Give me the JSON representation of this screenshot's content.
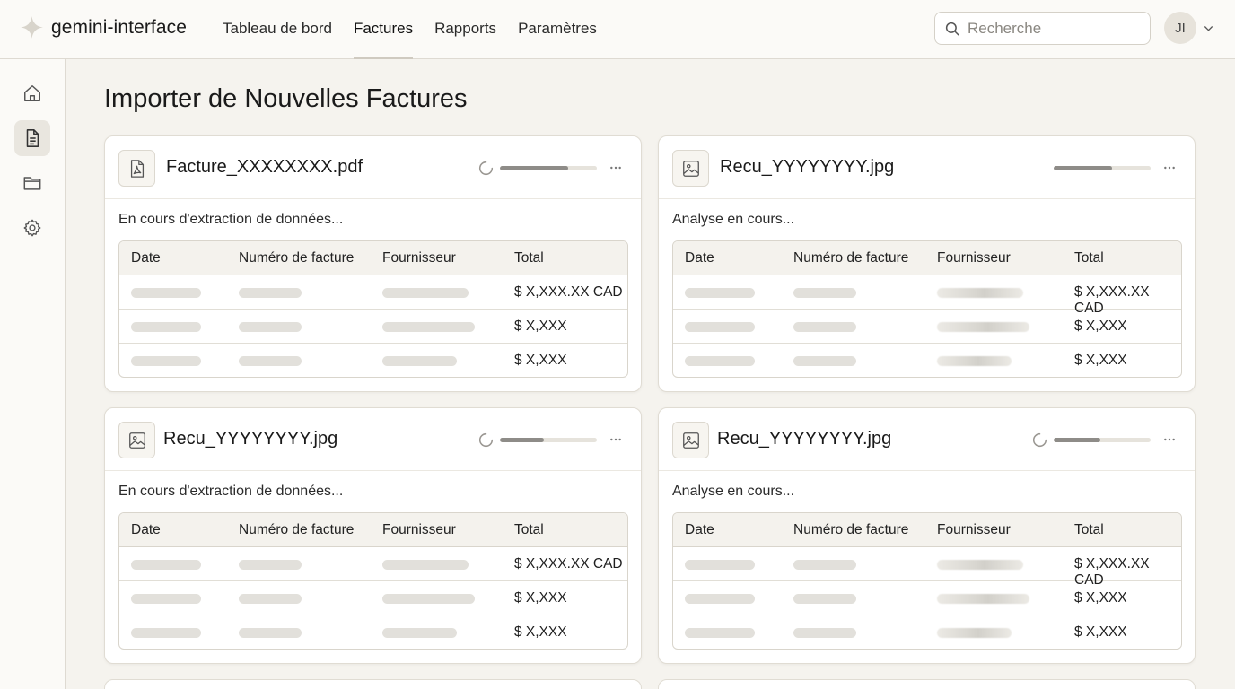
{
  "app": {
    "name": "gemini-interface"
  },
  "nav": {
    "items": [
      {
        "label": "Tableau de bord",
        "active": false
      },
      {
        "label": "Factures",
        "active": true
      },
      {
        "label": "Rapports",
        "active": false
      },
      {
        "label": "Paramètres",
        "active": false
      }
    ]
  },
  "search": {
    "placeholder": "Recherche",
    "value": ""
  },
  "user": {
    "initials": "JI"
  },
  "sidebar": {
    "items": [
      {
        "icon": "home-icon",
        "active": false
      },
      {
        "icon": "document-icon",
        "active": true
      },
      {
        "icon": "folder-icon",
        "active": false
      },
      {
        "icon": "gear-icon",
        "active": false
      }
    ]
  },
  "page": {
    "title": "Importer de Nouvelles Factures"
  },
  "table_headers": [
    "Date",
    "Numéro de facture",
    "Fournisseur",
    "Total"
  ],
  "cards": [
    {
      "file_name": "Facture_XXXXXXXX.pdf",
      "file_type_icon": "pdf-icon",
      "loading": true,
      "progress": 0.7,
      "status": "En cours d'extraction de données...",
      "totals": [
        "$ X,XXX.XX CAD",
        "$ X,XXX",
        "$ X,XXX"
      ]
    },
    {
      "file_name": "Recu_YYYYYYYY.jpg",
      "file_type_icon": "image-icon",
      "loading": false,
      "progress": 0.6,
      "status": "Analyse en cours...",
      "totals": [
        "$ X,XXX.XX CAD",
        "$ X,XXX",
        "$ X,XXX"
      ]
    },
    {
      "file_name": "Recu_YYYYYYYY.jpg",
      "file_type_icon": "image-icon",
      "loading": true,
      "progress": 0.45,
      "status": "En cours d'extraction de données...",
      "totals": [
        "$ X,XXX.XX CAD",
        "$ X,XXX",
        "$ X,XXX"
      ]
    },
    {
      "file_name": "Recu_YYYYYYYY.jpg",
      "file_type_icon": "image-icon",
      "loading": true,
      "progress": 0.48,
      "status": "Analyse en cours...",
      "totals": [
        "$ X,XXX.XX CAD",
        "$ X,XXX",
        "$ X,XXX"
      ]
    }
  ]
}
